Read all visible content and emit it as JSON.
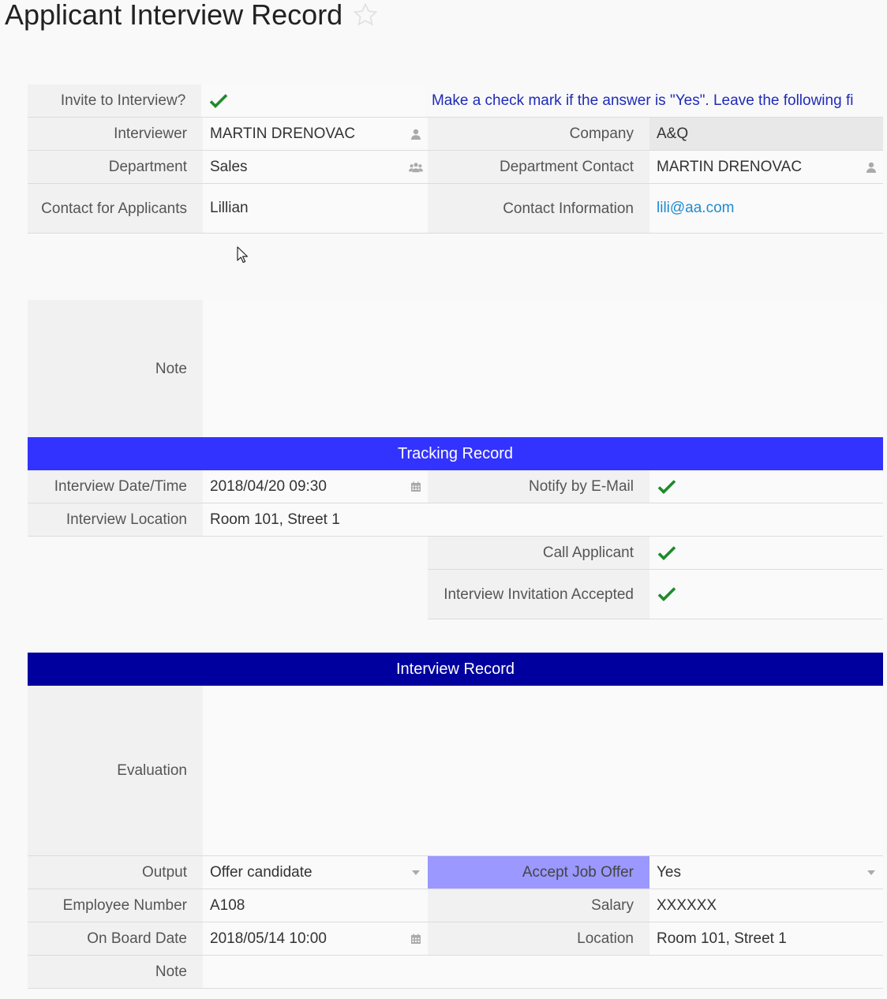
{
  "page": {
    "title": "Applicant Interview Record"
  },
  "colors": {
    "tracking_header": "#3333ff",
    "interview_header": "#00009e",
    "accept_highlight": "#9b98ff",
    "check": "#1e8a2a",
    "hint": "#1f2bb8",
    "link": "#1f8ad0"
  },
  "invite": {
    "label": "Invite to Interview?",
    "checked": true,
    "hint": "Make a check mark if the answer is \"Yes\". Leave the following fi"
  },
  "interviewer": {
    "label": "Interviewer",
    "value": "MARTIN DRENOVAC",
    "icon": "user-icon"
  },
  "company": {
    "label": "Company",
    "value": "A&Q"
  },
  "department": {
    "label": "Department",
    "value": "Sales",
    "icon": "group-icon"
  },
  "department_contact": {
    "label": "Department Contact",
    "value": "MARTIN DRENOVAC",
    "icon": "user-icon"
  },
  "contact_for_applicants": {
    "label": "Contact for Applicants",
    "value": "Lillian"
  },
  "contact_information": {
    "label": "Contact Information",
    "value": "lili@aa.com"
  },
  "note": {
    "label": "Note",
    "value": ""
  },
  "tracking": {
    "title": "Tracking Record",
    "interview_datetime": {
      "label": "Interview Date/Time",
      "value": "2018/04/20 09:30",
      "icon": "calendar-icon"
    },
    "notify_email": {
      "label": "Notify by E-Mail",
      "checked": true
    },
    "interview_location": {
      "label": "Interview Location",
      "value": "Room 101, Street 1"
    },
    "call_applicant": {
      "label": "Call Applicant",
      "checked": true
    },
    "invitation_accepted": {
      "label": "Interview Invitation Accepted",
      "checked": true
    }
  },
  "interview": {
    "title": "Interview Record",
    "evaluation": {
      "label": "Evaluation",
      "value": ""
    },
    "output": {
      "label": "Output",
      "value": "Offer candidate"
    },
    "accept_job_offer": {
      "label": "Accept Job Offer",
      "value": "Yes"
    },
    "employee_number": {
      "label": "Employee Number",
      "value": "A108"
    },
    "salary": {
      "label": "Salary",
      "value": "XXXXXX"
    },
    "on_board_date": {
      "label": "On Board Date",
      "value": "2018/05/14 10:00",
      "icon": "calendar-icon"
    },
    "location": {
      "label": "Location",
      "value": "Room 101, Street 1"
    },
    "note": {
      "label": "Note",
      "value": ""
    }
  }
}
